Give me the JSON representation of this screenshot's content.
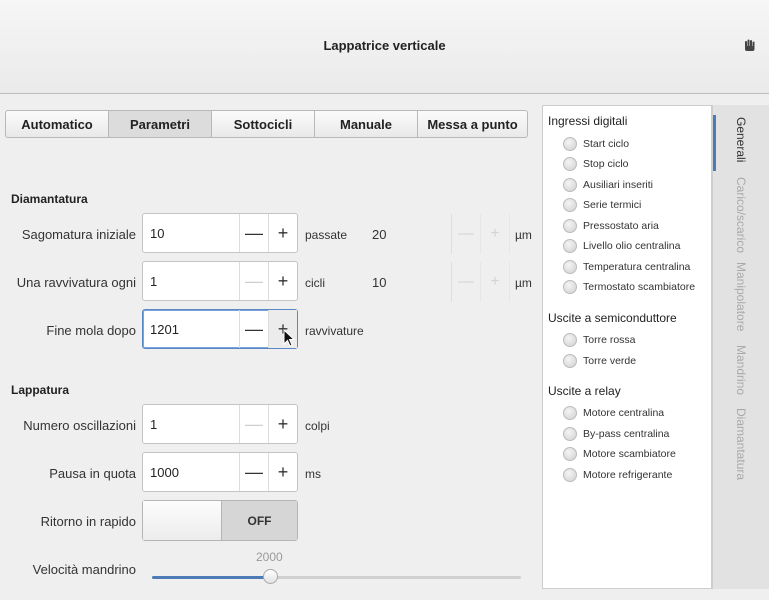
{
  "window": {
    "title": "Lappatrice verticale",
    "icon": "hand-icon"
  },
  "tabs": [
    "Automatico",
    "Parametri",
    "Sottocicli",
    "Manuale",
    "Messa a punto"
  ],
  "active_tab": "Parametri",
  "diamantatura": {
    "title": "Diamantatura",
    "sagomatura": {
      "label": "Sagomatura iniziale",
      "value": "10",
      "unit": "passate",
      "readout": "20",
      "readout_unit": "µm"
    },
    "ravvivatura": {
      "label": "Una ravvivatura ogni",
      "value": "1",
      "unit": "cicli",
      "readout": "10",
      "readout_unit": "µm"
    },
    "fine_mola": {
      "label": "Fine mola dopo",
      "value": "1201",
      "unit": "ravvivature"
    }
  },
  "lappatura": {
    "title": "Lappatura",
    "oscillazioni": {
      "label": "Numero oscillazioni",
      "value": "1",
      "unit": "colpi"
    },
    "pausa": {
      "label": "Pausa in quota",
      "value": "1000",
      "unit": "ms"
    },
    "ritorno": {
      "label": "Ritorno in rapido",
      "state": "OFF"
    },
    "velocita": {
      "label": "Velocità mandrino",
      "value": "2000",
      "fraction": 0.32
    }
  },
  "stepper": {
    "minus": "—",
    "plus": "+"
  },
  "ingressi": {
    "title": "Ingressi digitali",
    "items": [
      "Start ciclo",
      "Stop ciclo",
      "Ausiliari inseriti",
      "Serie termici",
      "Pressostato aria",
      "Livello olio centralina",
      "Temperatura centralina",
      "Termostato scambiatore"
    ]
  },
  "semiconduttore": {
    "title": "Uscite a semiconduttore",
    "items": [
      "Torre rossa",
      "Torre verde"
    ]
  },
  "relay": {
    "title": "Uscite a relay",
    "items": [
      "Motore centralina",
      "By-pass centralina",
      "Motore scambiatore",
      "Motore refrigerante"
    ]
  },
  "side_tabs": [
    "Generali",
    "Carico/scarico",
    "Manipolatore",
    "Mandrino",
    "Diamantatura"
  ],
  "colors": {
    "accent": "#4d7bb8",
    "panel": "#efefef"
  }
}
